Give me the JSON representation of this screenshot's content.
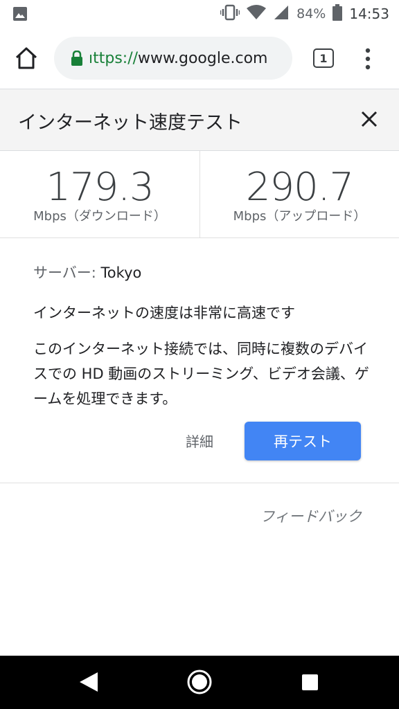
{
  "status_bar": {
    "battery": "84%",
    "time": "14:53",
    "icons": [
      "image-icon",
      "vibrate-icon",
      "wifi-icon",
      "signal-icon",
      "battery-icon"
    ]
  },
  "toolbar": {
    "url_scheme": "ıttps://",
    "url_host": "www.google.com",
    "tab_count": "1",
    "colors": {
      "lock": "#188038",
      "scheme": "#188038"
    }
  },
  "card": {
    "title": "インターネット速度テスト",
    "download": {
      "value": "179.3",
      "unit": "Mbps（ダウンロード）"
    },
    "upload": {
      "value": "290.7",
      "unit": "Mbps（アップロード）"
    },
    "server_label": "サーバー: ",
    "server_value": "Tokyo",
    "speed_summary": "インターネットの速度は非常に高速です",
    "description": "このインターネット接続では、同時に複数のデバイスでの HD 動画のストリーミング、ビデオ会議、ゲームを処理できます。",
    "details_label": "詳細",
    "retest_label": "再テスト",
    "feedback_label": "フィードバック",
    "colors": {
      "retest_button": "#4285f4",
      "header_bg": "#f4f4f4"
    }
  },
  "nav_bar": {
    "icons": [
      "back-icon",
      "home-circle-icon",
      "recents-icon"
    ]
  }
}
